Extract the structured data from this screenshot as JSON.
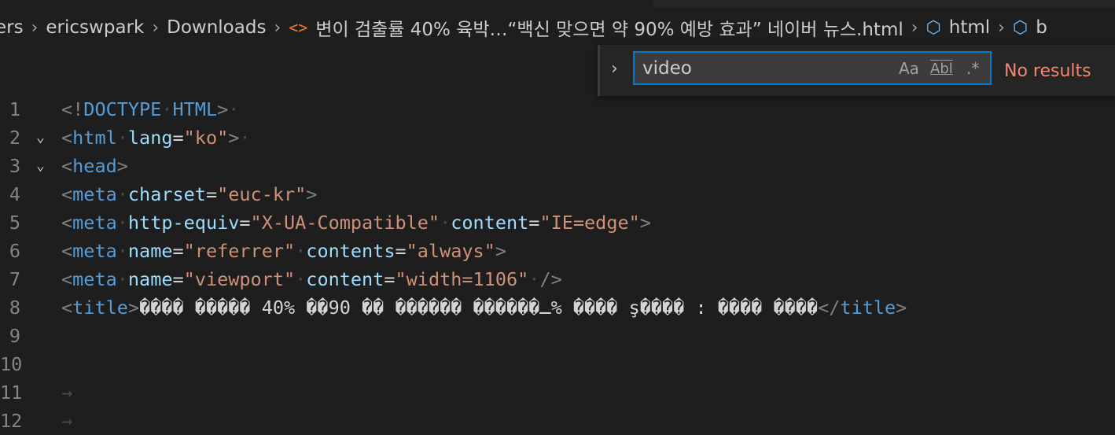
{
  "breadcrumb": {
    "items": [
      "ers",
      "ericswpark",
      "Downloads",
      "변이 검출률 40% 육박…“백신 맞으면 약 90% 예방 효과” 네이버 뉴스.html",
      "html",
      "b"
    ],
    "file_icon": "code-brackets-icon",
    "symbol_icon": "cube-icon"
  },
  "find": {
    "value": "video",
    "match_case": "Aa",
    "whole_word": "Abl",
    "regex": ".*",
    "status": "No results"
  },
  "lines": [
    {
      "n": "1",
      "fold": "",
      "parts": [
        [
          "tg",
          "<!"
        ],
        [
          "tn",
          "DOCTYPE"
        ],
        [
          "ws",
          "·"
        ],
        [
          "tn",
          "HTML"
        ],
        [
          "tg",
          ">"
        ],
        [
          "ws",
          "·"
        ]
      ]
    },
    {
      "n": "2",
      "fold": "⌄",
      "parts": [
        [
          "tg",
          "<"
        ],
        [
          "tn",
          "html"
        ],
        [
          "ws",
          "·"
        ],
        [
          "at",
          "lang"
        ],
        [
          "tx",
          "="
        ],
        [
          "st",
          "\"ko\""
        ],
        [
          "tg",
          ">"
        ],
        [
          "ws",
          "·"
        ]
      ]
    },
    {
      "n": "3",
      "fold": "⌄",
      "parts": [
        [
          "tg",
          "<"
        ],
        [
          "tn",
          "head"
        ],
        [
          "tg",
          ">"
        ]
      ]
    },
    {
      "n": "4",
      "fold": "",
      "parts": [
        [
          "tg",
          "<"
        ],
        [
          "tn",
          "meta"
        ],
        [
          "ws",
          "·"
        ],
        [
          "at",
          "charset"
        ],
        [
          "tx",
          "="
        ],
        [
          "st",
          "\"euc-kr\""
        ],
        [
          "tg",
          ">"
        ]
      ]
    },
    {
      "n": "5",
      "fold": "",
      "parts": [
        [
          "tg",
          "<"
        ],
        [
          "tn",
          "meta"
        ],
        [
          "ws",
          "·"
        ],
        [
          "at",
          "http-equiv"
        ],
        [
          "tx",
          "="
        ],
        [
          "st",
          "\"X-UA-Compatible\""
        ],
        [
          "ws",
          "·"
        ],
        [
          "at",
          "content"
        ],
        [
          "tx",
          "="
        ],
        [
          "st",
          "\"IE=edge\""
        ],
        [
          "tg",
          ">"
        ]
      ]
    },
    {
      "n": "6",
      "fold": "",
      "parts": [
        [
          "tg",
          "<"
        ],
        [
          "tn",
          "meta"
        ],
        [
          "ws",
          "·"
        ],
        [
          "at",
          "name"
        ],
        [
          "tx",
          "="
        ],
        [
          "st",
          "\"referrer\""
        ],
        [
          "ws",
          "·"
        ],
        [
          "at",
          "contents"
        ],
        [
          "tx",
          "="
        ],
        [
          "st",
          "\"always\""
        ],
        [
          "tg",
          ">"
        ]
      ]
    },
    {
      "n": "7",
      "fold": "",
      "parts": [
        [
          "tg",
          "<"
        ],
        [
          "tn",
          "meta"
        ],
        [
          "ws",
          "·"
        ],
        [
          "at",
          "name"
        ],
        [
          "tx",
          "="
        ],
        [
          "st",
          "\"viewport\""
        ],
        [
          "ws",
          "·"
        ],
        [
          "at",
          "content"
        ],
        [
          "tx",
          "="
        ],
        [
          "st",
          "\"width=1106\""
        ],
        [
          "ws",
          "·"
        ],
        [
          "tg",
          "/>"
        ]
      ]
    },
    {
      "n": "8",
      "fold": "",
      "parts": [
        [
          "tg",
          "<"
        ],
        [
          "tn",
          "title"
        ],
        [
          "tg",
          ">"
        ],
        [
          "tx",
          "���� ����� 40% ��90 �� ������ ������ـ% ���� ş���� : ���� ����"
        ],
        [
          "tg",
          "</"
        ],
        [
          "tn",
          "title"
        ],
        [
          "tg",
          ">"
        ]
      ]
    },
    {
      "n": "9",
      "fold": "",
      "parts": []
    },
    {
      "n": "10",
      "fold": "",
      "parts": []
    },
    {
      "n": "11",
      "fold": "",
      "parts": [
        [
          "ws",
          "→"
        ]
      ]
    },
    {
      "n": "12",
      "fold": "",
      "parts": [
        [
          "ws",
          "→"
        ]
      ]
    }
  ]
}
